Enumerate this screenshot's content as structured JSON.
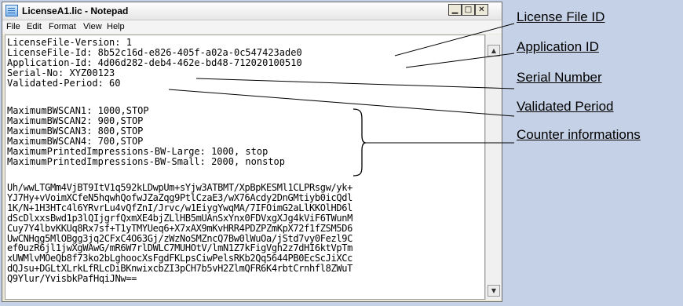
{
  "window": {
    "title": "LicenseA1.lic - Notepad",
    "controls": {
      "minimize": "▁",
      "maximize": "□",
      "close": "✕"
    }
  },
  "menu": [
    "File",
    "Edit",
    "Format",
    "View",
    "Help"
  ],
  "content": {
    "header_lines": [
      "LicenseFile-Version: 1",
      "LicenseFile-Id: 8b52c16d-e826-405f-a02a-0c547423ade0",
      "Application-Id: 4d06d282-deb4-462e-bd48-712020100510",
      "Serial-No: XYZ00123",
      "Validated-Period: 60"
    ],
    "counter_lines": [
      "MaximumBWSCAN1: 1000,STOP",
      "MaximumBWSCAN2: 900,STOP",
      "MaximumBWSCAN3: 800,STOP",
      "MaximumBWSCAN4: 700,STOP",
      "MaximumPrintedImpressions-BW-Large: 1000, stop",
      "MaximumPrintedImpressions-BW-Small: 2000, nonstop"
    ],
    "signature_lines": [
      "Uh/wwLTGMm4VjBT9ItV1q592kLDwpUm+sYjw3ATBMT/XpBpKESMl1CLPRsgw/yk+",
      "YJ7Hy+vVoimXCfeN5hqwhQofwJZaZqg9PtlCzaE3/wX76Acdy2DnGMtiyb0icQdl",
      "1K/N+1H3HTc4l6YRvrLu4vQfZnI/Jrvc/w1EiygYwqMA/7IFOimG2aLlKKOlHD6l",
      "dScDlxxsBwd1p3lQIjgrfQxmXE4bjZLlHB5mUAnSxYnx0FDVxgXJg4kViF6TWunM",
      "Cuy7Y4lbvKKUq8Rx7sf+T1yTMYUeq6+X7xAX9mKvHRR4PDZPZmKpX72f1fZSM5D6",
      "UwCNHqg5MlOBgg3jq2CFxC4O63Gj/zWzNoSMZncQ7Bw0lWuOa/jStd7vy0Fezl9C",
      "ef0uzR6jl1jwXgWAwG/mR6W7rlDWLC7MUHOtV/lmN1Z7kFigVgh2z7dHI6ktVpTm",
      "xUWMlvMOeQb8f73ko2bLghoocXsFgdFKLpsCiwPelsRKb2Qq5644PB0EcScJiXCc",
      "dQJsu+DGLtXLrkLfRLcDiBKnwixcbZI3pCH7b5vH2ZlmQFR6K4rbtCrnhfl8ZWuT",
      "Q9Ylur/YvisbkPafHqiJNw=="
    ]
  },
  "callouts": {
    "license_file_id": "License File ID",
    "application_id": "Application ID",
    "serial_number": "Serial Number",
    "validated_period": "Validated Period",
    "counter_informations": "Counter informations"
  },
  "scrollbar": {
    "up": "▲",
    "down": "▼"
  }
}
